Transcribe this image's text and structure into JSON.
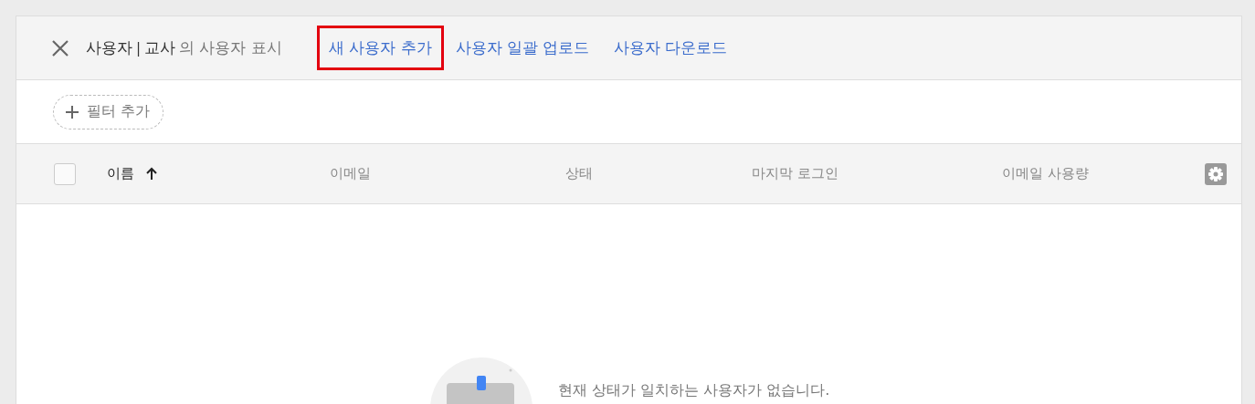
{
  "header": {
    "title_parts": [
      {
        "text": "사용자",
        "kind": "strong"
      },
      {
        "text": "|",
        "kind": "separator"
      },
      {
        "text": "교사",
        "kind": "strong"
      },
      {
        "text": "의 사용자 표시",
        "kind": "muted"
      }
    ],
    "actions": [
      {
        "label": "새 사용자 추가",
        "highlighted": true
      },
      {
        "label": "사용자 일괄 업로드",
        "highlighted": false
      },
      {
        "label": "사용자 다운로드",
        "highlighted": false
      }
    ]
  },
  "filter": {
    "label": "필터 추가"
  },
  "table": {
    "select_all": {
      "checked": false
    },
    "columns": [
      {
        "label": "이름",
        "sorted": true
      },
      {
        "label": "이메일",
        "sorted": false
      },
      {
        "label": "상태",
        "sorted": false
      },
      {
        "label": "마지막 로그인",
        "sorted": false
      },
      {
        "label": "이메일 사용량",
        "sorted": false
      }
    ]
  },
  "empty_state": {
    "message": "현재 상태가 일치하는 사용자가 없습니다."
  }
}
